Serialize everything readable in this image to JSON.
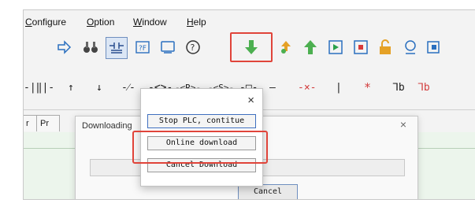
{
  "menu": [
    {
      "label": "Configure",
      "underline": "C"
    },
    {
      "label": "Option",
      "underline": "O"
    },
    {
      "label": "Window",
      "underline": "W"
    },
    {
      "label": "Help",
      "underline": "H"
    }
  ],
  "toolbar_icons": [
    "arrow-right-icon",
    "binoculars-icon",
    "ladder-contact-icon",
    "find-replace-icon",
    "monitor-icon",
    "help-icon",
    "download-icon",
    "upload-lock-icon",
    "upload-icon",
    "run-icon",
    "stop-icon",
    "unlock-icon",
    "diagnostic-icon",
    "more-icon"
  ],
  "ladder_toolbar": [
    {
      "glyph": "-|‖|-",
      "name": "parallel-contact-icon"
    },
    {
      "glyph": "↑",
      "name": "rising-edge-icon"
    },
    {
      "glyph": "↓",
      "name": "falling-edge-icon"
    },
    {
      "glyph": "-⁄-",
      "name": "vertical-line-icon"
    },
    {
      "glyph": "-<>-",
      "name": "coil-icon"
    },
    {
      "glyph": "-<R>-",
      "name": "reset-coil-icon"
    },
    {
      "glyph": "-<S>-",
      "name": "set-coil-icon"
    },
    {
      "glyph": "-□-",
      "name": "function-block-icon"
    },
    {
      "glyph": "—",
      "name": "horizontal-line-icon"
    },
    {
      "glyph": "-×-",
      "name": "delete-line-icon",
      "red": true
    },
    {
      "glyph": "|",
      "name": "vertical-bar-icon"
    },
    {
      "glyph": "*",
      "name": "delete-vertical-icon",
      "red": true
    },
    {
      "glyph": "ᒣb",
      "name": "branch-icon"
    },
    {
      "glyph": "ᒣb",
      "name": "delete-branch-icon",
      "red": true
    }
  ],
  "tabs": [
    "r",
    "Pr"
  ],
  "download_dialog": {
    "title": "Downloading",
    "close": "×",
    "cancel_label": "Cancel"
  },
  "popup": {
    "close": "×",
    "options": [
      "Stop PLC, contitue",
      "Online download",
      "Cancel Download"
    ]
  },
  "colors": {
    "highlight": "#e0443a",
    "download_green": "#4caf50",
    "accent_blue": "#2f9bdc"
  }
}
